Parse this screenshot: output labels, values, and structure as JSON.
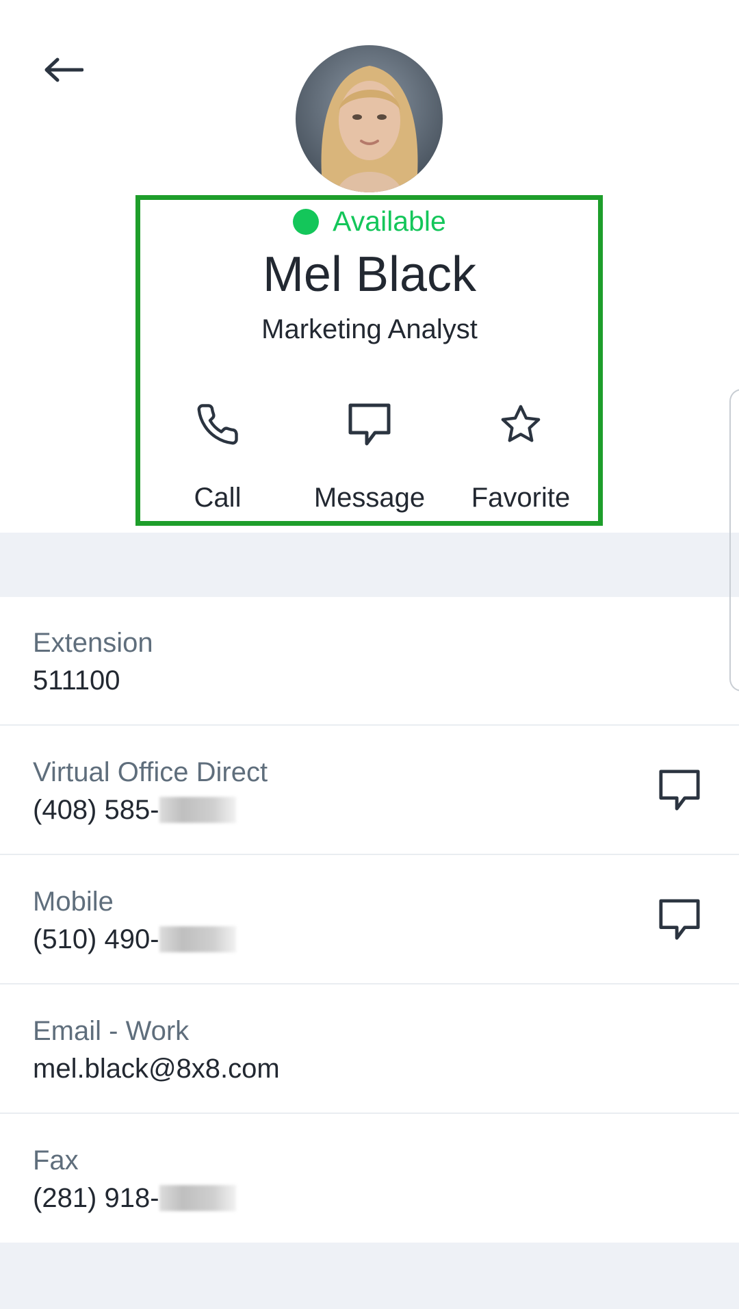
{
  "header": {
    "back_icon": "arrow-left-icon"
  },
  "profile": {
    "status": "Available",
    "status_color": "#14c65a",
    "name": "Mel Black",
    "job_title": "Marketing Analyst"
  },
  "actions": [
    {
      "label": "Call",
      "icon": "phone-icon"
    },
    {
      "label": "Message",
      "icon": "chat-bubble-icon"
    },
    {
      "label": "Favorite",
      "icon": "star-icon"
    }
  ],
  "details": [
    {
      "label": "Extension",
      "value": "511100"
    },
    {
      "label": "Virtual Office Direct",
      "value": "(408) 585-",
      "redacted": true,
      "message_icon": "chat-bubble-icon"
    },
    {
      "label": "Mobile",
      "value": "(510) 490-",
      "redacted": true,
      "message_icon": "chat-bubble-icon"
    },
    {
      "label": "Email - Work",
      "value": "mel.black@8x8.com"
    },
    {
      "label": "Fax",
      "value": "(281) 918-",
      "redacted": true
    }
  ],
  "colors": {
    "accent_green": "#14c65a",
    "highlight_border": "#1e9e2b",
    "section_band": "#eef1f6",
    "label_gray": "#5f6e7c",
    "text_dark": "#222831"
  }
}
